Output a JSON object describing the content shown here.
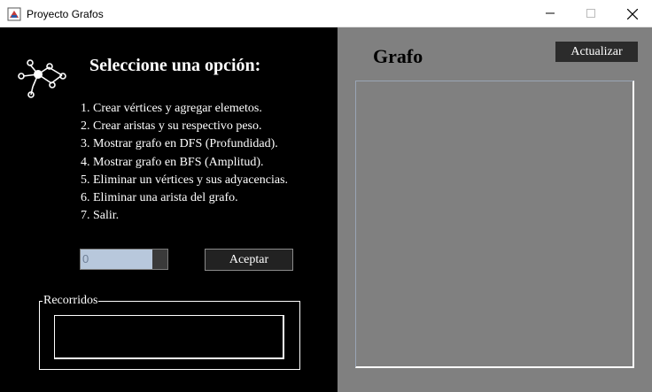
{
  "window": {
    "title": "Proyecto Grafos"
  },
  "menu": {
    "heading": "Seleccione una opción:",
    "options": [
      "1. Crear vértices y agregar elemetos.",
      "2. Crear aristas y su respectivo peso.",
      "3. Mostrar grafo en DFS (Profundidad).",
      "4. Mostrar grafo en BFS (Amplitud).",
      "5. Eliminar un vértices y sus adyacencias.",
      "6. Eliminar una arista del grafo.",
      "7. Salir."
    ],
    "input_value": "0",
    "accept_label": "Aceptar",
    "recorridos_label": "Recorridos",
    "recorridos_value": ""
  },
  "graph_panel": {
    "title": "Grafo",
    "update_label": "Actualizar"
  },
  "colors": {
    "left_bg": "#000000",
    "right_bg": "#808080"
  }
}
